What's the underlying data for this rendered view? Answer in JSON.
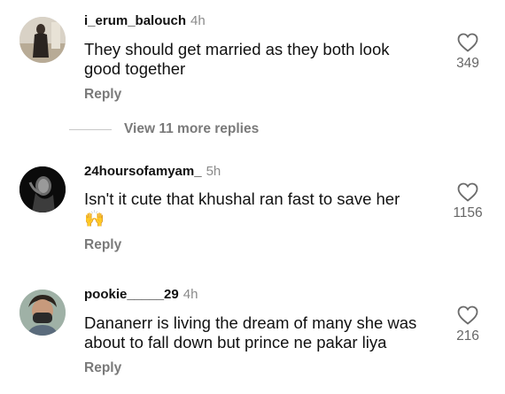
{
  "comments": [
    {
      "username": "i_erum_balouch",
      "time": "4h",
      "text_lines": [
        "They should get married as they both look",
        "good together"
      ],
      "reply_label": "Reply",
      "likes": "349",
      "avatar_icon": "profile-photo"
    },
    {
      "username": "24hoursofamyam_",
      "time": "5h",
      "text_lines": [
        "Isn't it cute that khushal ran fast to save her",
        "🙌"
      ],
      "reply_label": "Reply",
      "likes": "1156",
      "avatar_icon": "profile-photo"
    },
    {
      "username": "pookie_____29",
      "time": "4h",
      "text_lines": [
        "Dananerr is living the dream of many she was",
        "about to fall down but prince ne pakar liya"
      ],
      "reply_label": "Reply",
      "likes": "216",
      "avatar_icon": "profile-photo"
    }
  ],
  "view_more_label": "View 11 more replies",
  "icons": {
    "like": "heart-outline-icon"
  }
}
